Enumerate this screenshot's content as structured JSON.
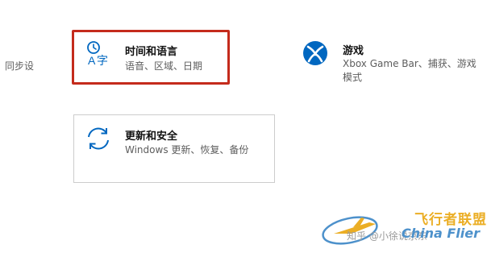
{
  "left_cut_label": "同步设",
  "tiles": {
    "time_language": {
      "title": "时间和语言",
      "description": "语音、区域、日期",
      "icon": "time-language-icon",
      "highlighted": true,
      "highlight_color": "#c42b1c"
    },
    "gaming": {
      "title": "游戏",
      "description": "Xbox Game Bar、捕获、游戏模式",
      "icon": "xbox-icon"
    },
    "update_security": {
      "title": "更新和安全",
      "description": "Windows 更新、恢复、备份",
      "icon": "sync-arrows-icon"
    }
  },
  "accent_color": "#0067c0",
  "watermark": {
    "brand_cn": "飞行者联盟",
    "brand_en": "China Flier",
    "credit": "知乎 @小徐说京东"
  }
}
